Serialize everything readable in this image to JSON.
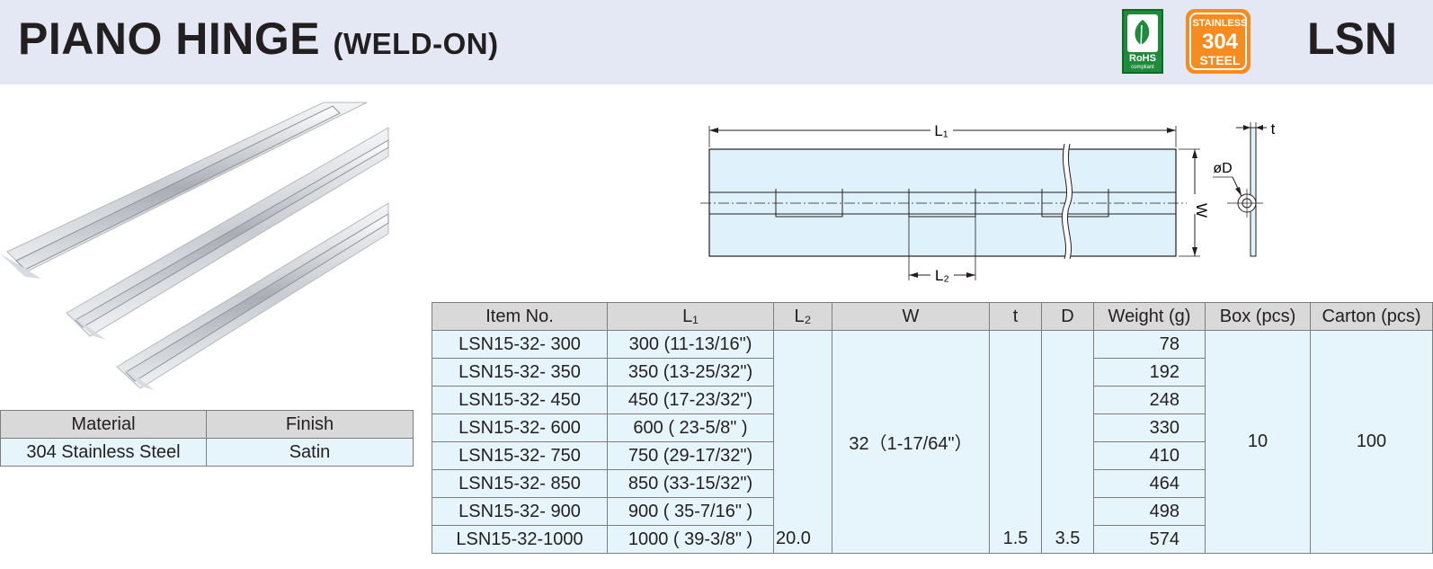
{
  "header": {
    "title": "PIANO HINGE",
    "subtitle": "(WELD-ON)",
    "series": "LSN",
    "badges": {
      "rohs_line1": "RoHS",
      "rohs_line2": "compliant",
      "ss_line1": "STAINLESS",
      "ss_line2": "304",
      "ss_line3": "STEEL"
    }
  },
  "diagram": {
    "l1": "L₁",
    "l2": "L₂",
    "w": "W",
    "t": "t",
    "d": "øD"
  },
  "material_table": {
    "headers": [
      "Material",
      "Finish"
    ],
    "material": "304 Stainless Steel",
    "finish": "Satin"
  },
  "spec_table": {
    "headers": [
      "Item No.",
      "L₁",
      "L₂",
      "W",
      "t",
      "D",
      "Weight (g)",
      "Box (pcs)",
      "Carton (pcs)"
    ],
    "rows": [
      {
        "item": "LSN15-32-  300",
        "l1": "300 (11-13/16\")",
        "weight": "78"
      },
      {
        "item": "LSN15-32-  350",
        "l1": "350 (13-25/32\")",
        "weight": "192"
      },
      {
        "item": "LSN15-32-  450",
        "l1": "450 (17-23/32\")",
        "weight": "248"
      },
      {
        "item": "LSN15-32-  600",
        "l1": "600 (  23-5/8\"  )",
        "weight": "330"
      },
      {
        "item": "LSN15-32-  750",
        "l1": "750 (29-17/32\")",
        "weight": "410"
      },
      {
        "item": "LSN15-32-  850",
        "l1": "850 (33-15/32\")",
        "weight": "464"
      },
      {
        "item": "LSN15-32-  900",
        "l1": "900 ( 35-7/16\" )",
        "weight": "498"
      },
      {
        "item": "LSN15-32-1000",
        "l1": "1000 (  39-3/8\"  )",
        "weight": "574"
      }
    ],
    "l2": "20.0",
    "w": "32（1-17/64\"）",
    "t": "1.5",
    "d": "3.5",
    "box": "10",
    "carton": "100"
  },
  "colors": {
    "header_bg": "#e3e8f4",
    "cell_bg": "#e6f4fc",
    "head_bg": "#d9d9d9",
    "rohs_green": "#1e8a3c",
    "steel_orange": "#f68b1f"
  }
}
